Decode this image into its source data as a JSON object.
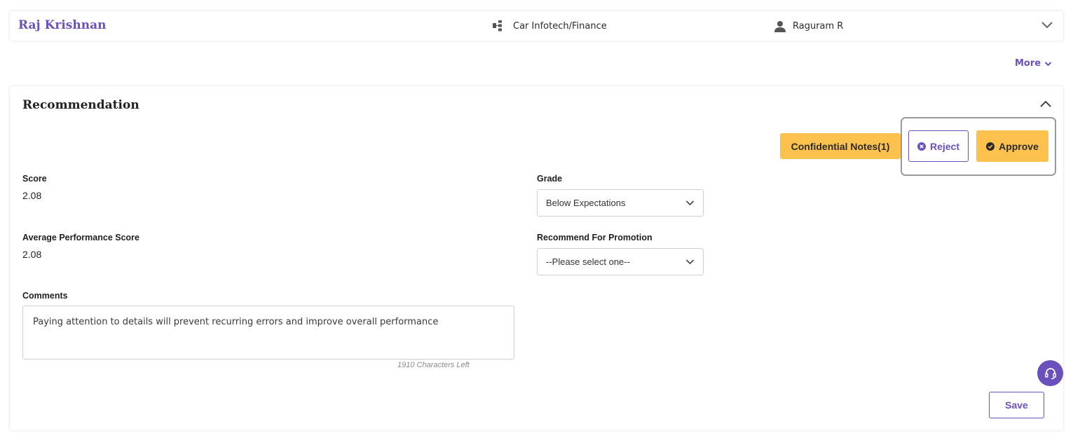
{
  "employee": {
    "name": "Raj Krishnan",
    "department": "Car Infotech/Finance",
    "manager": "Raguram R"
  },
  "more_label": "More",
  "recommendation": {
    "title": "Recommendation",
    "buttons": {
      "confidential_notes": "Confidential Notes(1)",
      "reject": "Reject",
      "approve": "Approve",
      "save": "Save"
    },
    "score": {
      "label": "Score",
      "value": "2.08"
    },
    "average_score": {
      "label": "Average Performance Score",
      "value": "2.08"
    },
    "grade": {
      "label": "Grade",
      "selected": "Below Expectations"
    },
    "promotion": {
      "label": "Recommend For Promotion",
      "selected": "--Please select one--"
    },
    "comments": {
      "label": "Comments",
      "value": "Paying attention to details will prevent recurring errors and improve overall performance",
      "chars_left": "1910 Characters Left"
    }
  },
  "colors": {
    "accent": "#6b4fbb",
    "primary_button": "#fdc24d",
    "focus_ring": "#9a9a9a"
  },
  "icons": {
    "department": "org-chart-icon",
    "manager": "person-icon",
    "expand": "chevron-down-icon",
    "collapse": "chevron-up-icon",
    "reject": "x-circle-icon",
    "approve": "check-circle-icon",
    "help": "headset-icon"
  }
}
